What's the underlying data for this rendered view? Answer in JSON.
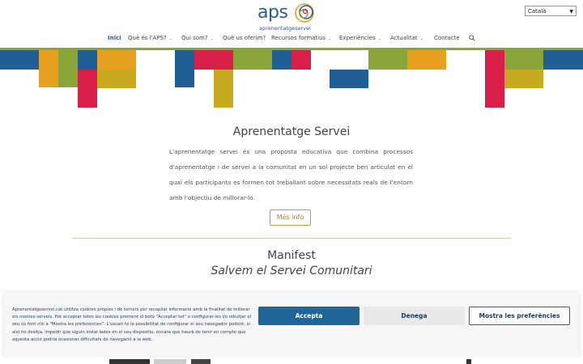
{
  "site": {
    "logo_text": "aps",
    "logo_tagline": "aprenentatgeservei"
  },
  "language": {
    "selected": "Català"
  },
  "nav": {
    "items": [
      {
        "label": "Inici",
        "has_caret": false
      },
      {
        "label": "Què és l'APS?",
        "has_caret": true
      },
      {
        "label": "Qui som?",
        "has_caret": true
      },
      {
        "label": "Què us oferim?",
        "has_caret": false
      },
      {
        "label": "Recursos formatius",
        "has_caret": true
      },
      {
        "label": "Experiències",
        "has_caret": true
      },
      {
        "label": "Actualitat",
        "has_caret": true
      },
      {
        "label": "Contacte",
        "has_caret": false
      }
    ],
    "caret_glyph": "⌄",
    "search_icon": "search-icon"
  },
  "hero": {
    "title": "Aprenentatge Servei",
    "text": "L'aprenentatge servei és una proposta educativa que combina processos d'aprenentatge i de servei a la comunitat en un sol projecte ben articulat en el qual els participants es formen tot treballant sobre necessitats reals de l'entorn amb l'objectiu de millorar-lo.",
    "button": "Més info"
  },
  "manifest": {
    "title": "Manifest",
    "subtitle": "Salvem el Servei Comunitari"
  },
  "cookie_banner": {
    "text": "Aprenentatgeservei.cat utilitza cookies pròpies i de tercers per recopilar informació amb la finalitat de millorar els nostres serveis. Pot acceptar totes les cookies prement el botó \"Acceptar tot\" o configurar-les i/o rebutjar el seu ús fent clic a \"Mostra les preferències\". L'usuari té la possibilitat de configurar el seu navegador podent, si així ho desitja, impedir que siguin instal·lades en el seu dispositiu, encara que haurà de tenir en compte que aquesta acció podria ocasionar dificultats de navegació a la web.",
    "accept": "Accepta",
    "deny": "Denega",
    "preferences": "Mostra les preferències"
  },
  "colors": {
    "brand_blue": "#2a5c96",
    "mosaic_blue": "#1f5f96",
    "mosaic_orange": "#e8a020",
    "mosaic_green": "#8aa63a",
    "mosaic_red": "#d81f4a",
    "mosaic_yellow": "#c8aa20",
    "button_gold": "#b8a13a",
    "cookie_accept": "#1f6596"
  }
}
